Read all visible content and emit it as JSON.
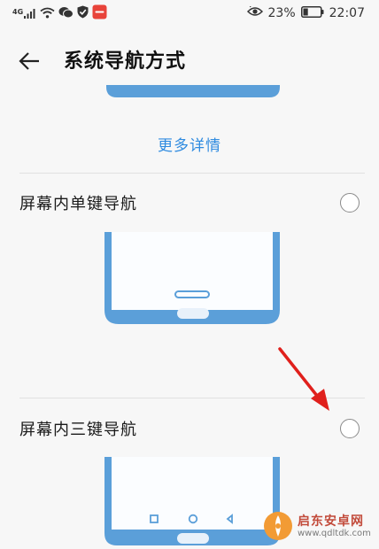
{
  "status_bar": {
    "signal": "4G",
    "battery_percent": "23%",
    "time": "22:07",
    "icons": [
      "signal-icon",
      "wifi-icon",
      "wechat-icon",
      "shield-icon",
      "app-notification-icon",
      "eye-comfort-icon",
      "battery-icon"
    ]
  },
  "header": {
    "title": "系统导航方式",
    "back_icon": "back-arrow-icon"
  },
  "more_link": "更多详情",
  "options": [
    {
      "label": "屏幕内单键导航",
      "selected": false
    },
    {
      "label": "屏幕内三键导航",
      "selected": false
    }
  ],
  "watermark": {
    "name": "启东安卓网",
    "url": "www.qdltdk.com"
  },
  "colors": {
    "accent": "#2f8be0",
    "phone_frame": "#5b9fd9",
    "annotation": "#e0201c"
  }
}
